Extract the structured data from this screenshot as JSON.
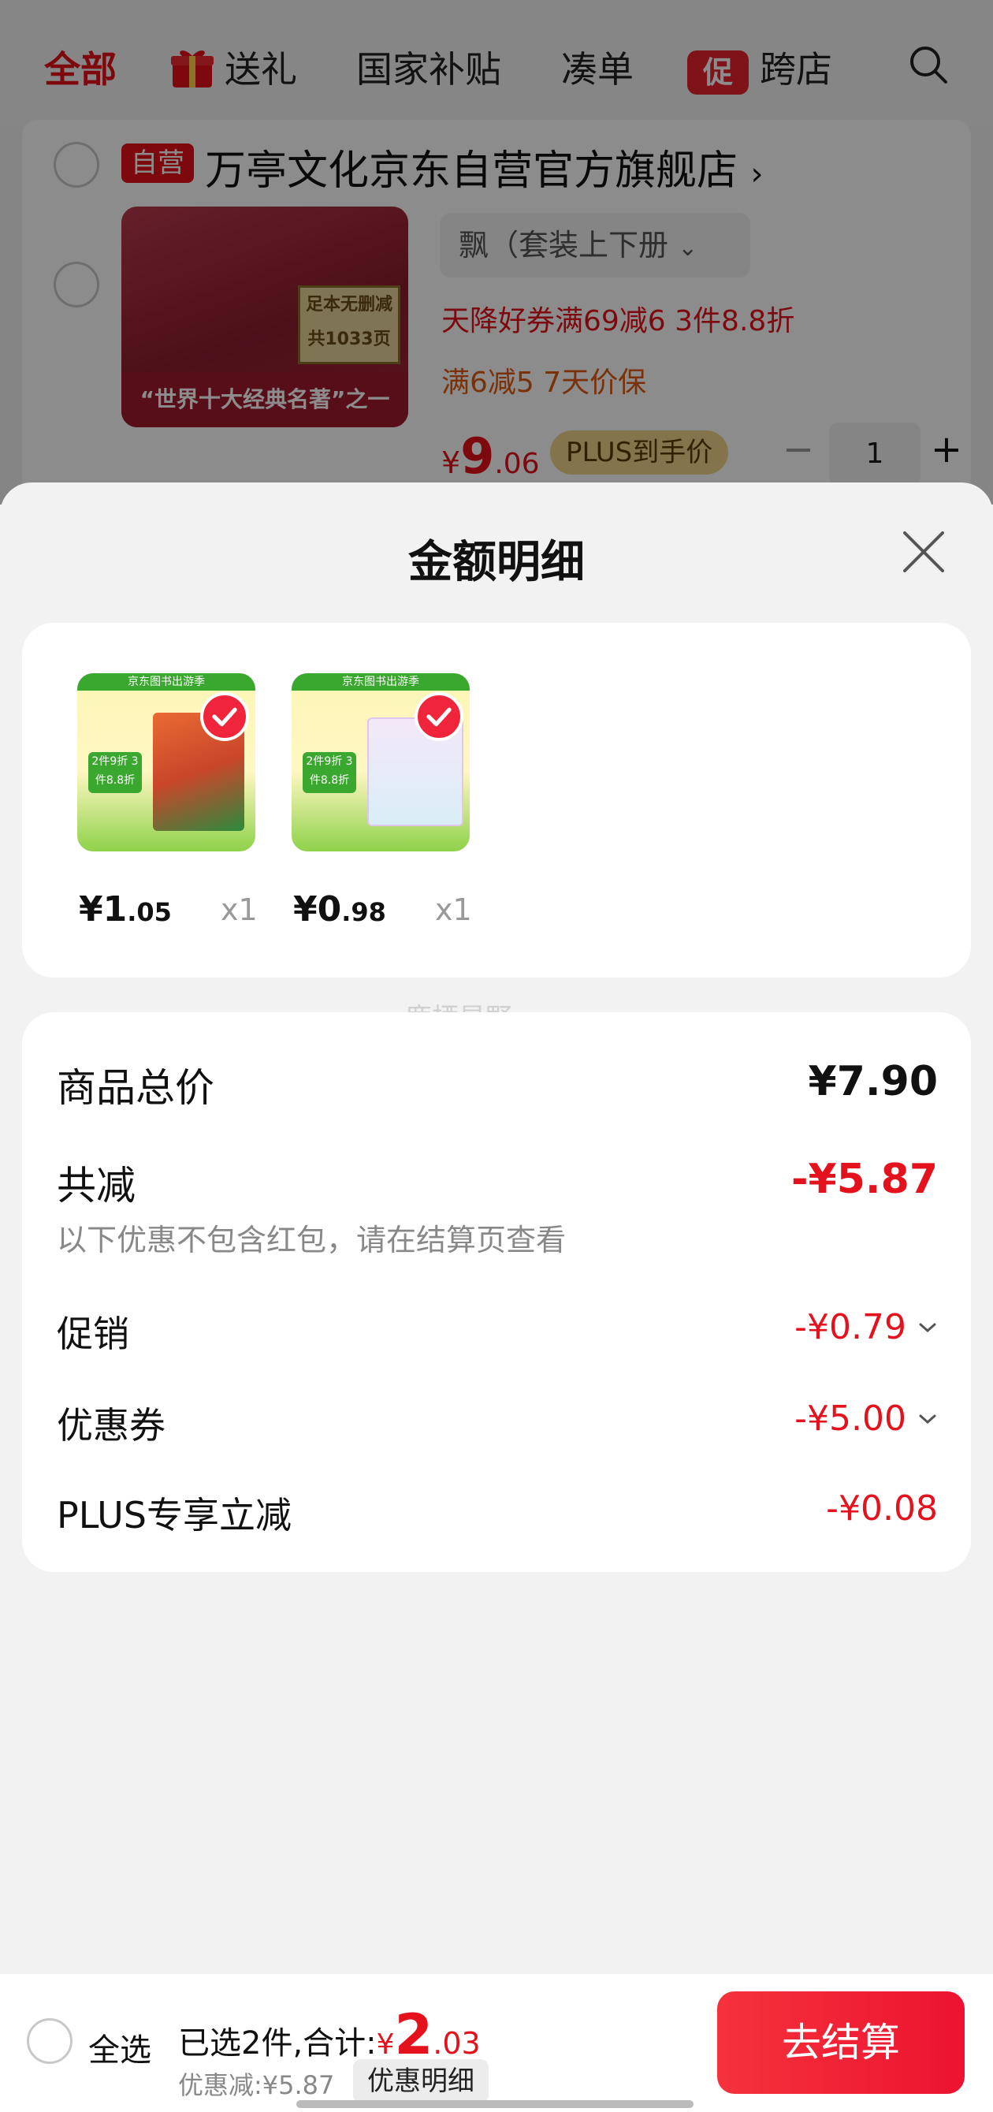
{
  "top_tabs": {
    "all": "全部",
    "gift": "送礼",
    "subsidy": "国家补贴",
    "combine": "凑单",
    "promo_badge": "促",
    "cross_store": "跨店"
  },
  "store": {
    "self_badge": "自营",
    "name": "万亭文化京东自营官方旗舰店",
    "name_chevron": "›"
  },
  "product": {
    "variant": "飘（套装上下册",
    "variant_chevron": "⌄",
    "image_sticker": "足本无删减 共1033页",
    "image_caption": "“世界十大经典名著”之一",
    "promo_line_1": "天降好券满69减6  3件8.8折",
    "promo_line_2": "满6减5  7天价保",
    "price_symbol": "¥",
    "price_int": "9",
    "price_dec": ".06",
    "plus_tag": "PLUS到手价",
    "qty_minus": "−",
    "quantity": "1",
    "qty_plus": "+"
  },
  "sheet": {
    "title": "金额明细",
    "close_icon": "close-icon",
    "items": [
      {
        "price_symbol": "¥",
        "price_int": "1",
        "price_dec": ".05",
        "qty": "x1",
        "band_text": "京东图书出游季",
        "deal_text": "2件9折 3件8.8折"
      },
      {
        "price_symbol": "¥",
        "price_int": "0",
        "price_dec": ".98",
        "qty": "x1",
        "band_text": "京东图书出游季",
        "deal_text": "2件9折 3件8.8折"
      }
    ],
    "watermark": "鹿栖星野"
  },
  "details": {
    "total_label": "商品总价",
    "total_value": "¥7.90",
    "reduce_label": "共减",
    "reduce_value": "-¥5.87",
    "reduce_note": "以下优惠不包含红包，请在结算页查看",
    "promo_label": "促销",
    "promo_value": "-¥0.79",
    "coupon_label": "优惠券",
    "coupon_value": "-¥5.00",
    "plus_label": "PLUS专享立减",
    "plus_value": "-¥0.08"
  },
  "bottom": {
    "select_all": "全选",
    "selected_summary": "已选2件,合计:",
    "total_symbol": "¥",
    "total_int": "2",
    "total_dec": ".03",
    "discount": "优惠减:¥5.87",
    "detail_link": "优惠明细",
    "checkout": "去结算"
  },
  "colors": {
    "accent_red": "#e4121d",
    "checkout_gradient_start": "#f5323c",
    "plus_gold": "#f0d48a"
  }
}
